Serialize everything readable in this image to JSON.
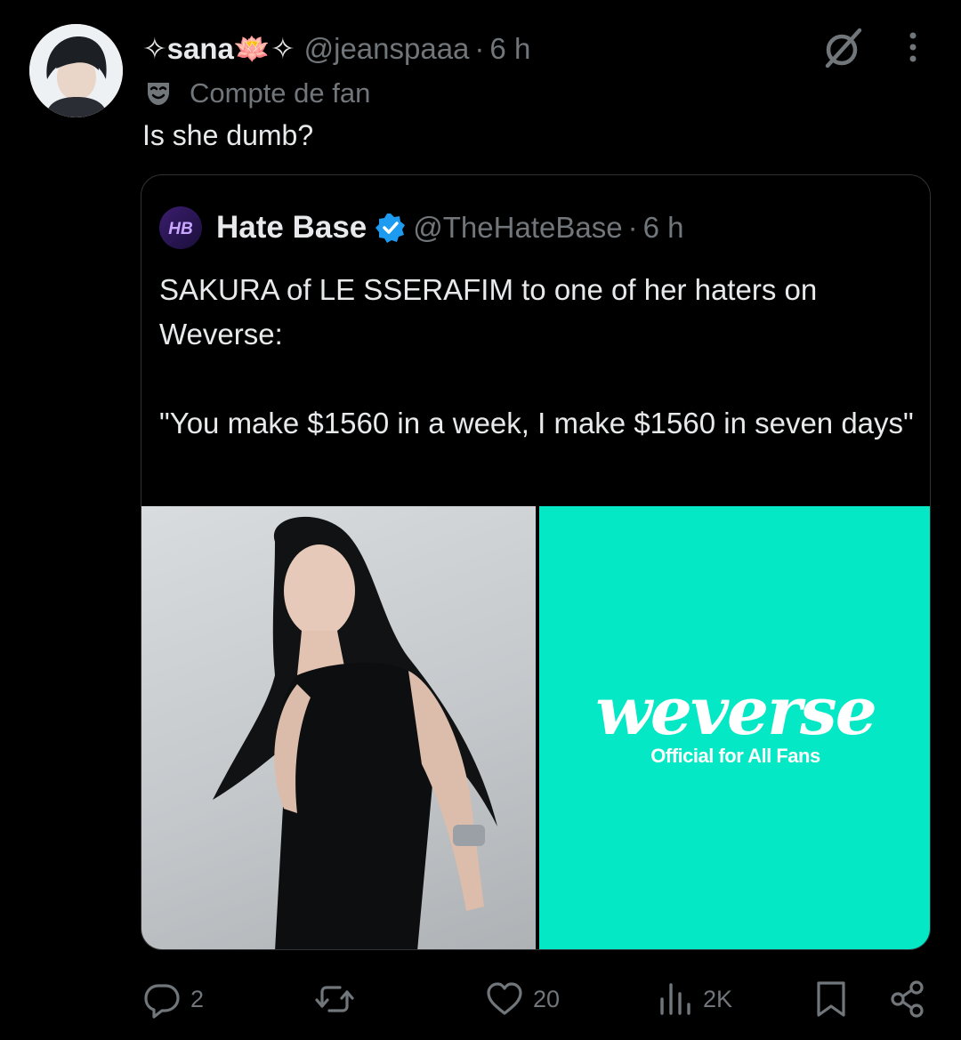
{
  "post": {
    "author": {
      "display_name": "✧sana🪷✧",
      "handle": "@jeanspaaa",
      "separator": "·",
      "time": "6 h",
      "avatar_icon": "user-avatar-photo"
    },
    "fan_badge": {
      "icon": "theater-mask-icon",
      "label": "Compte de fan"
    },
    "text": "Is she dumb?",
    "quote": {
      "author": {
        "display_name": "Hate Base",
        "handle": "@TheHateBase",
        "separator": "·",
        "time": "6 h",
        "avatar_text": "HB",
        "verified": true,
        "verified_color": "#1d9bf0"
      },
      "text_lines": [
        "SAKURA of LE SSERAFIM to one of her haters on Weverse:",
        "\"You make $1560 in a week, I make $1560 in seven days\""
      ],
      "media": {
        "left_image": "woman-in-black-dress-photo",
        "right_image": {
          "logo_text": "weverse",
          "tagline": "Official for All Fans",
          "background": "#05e8c6"
        }
      }
    }
  },
  "actions": {
    "reply_count": "2",
    "repost_count": "",
    "like_count": "20",
    "views_count": "2K"
  },
  "colors": {
    "background": "#000000",
    "text_primary": "#e7e9ea",
    "text_secondary": "#71767b",
    "border": "#2f3336"
  }
}
